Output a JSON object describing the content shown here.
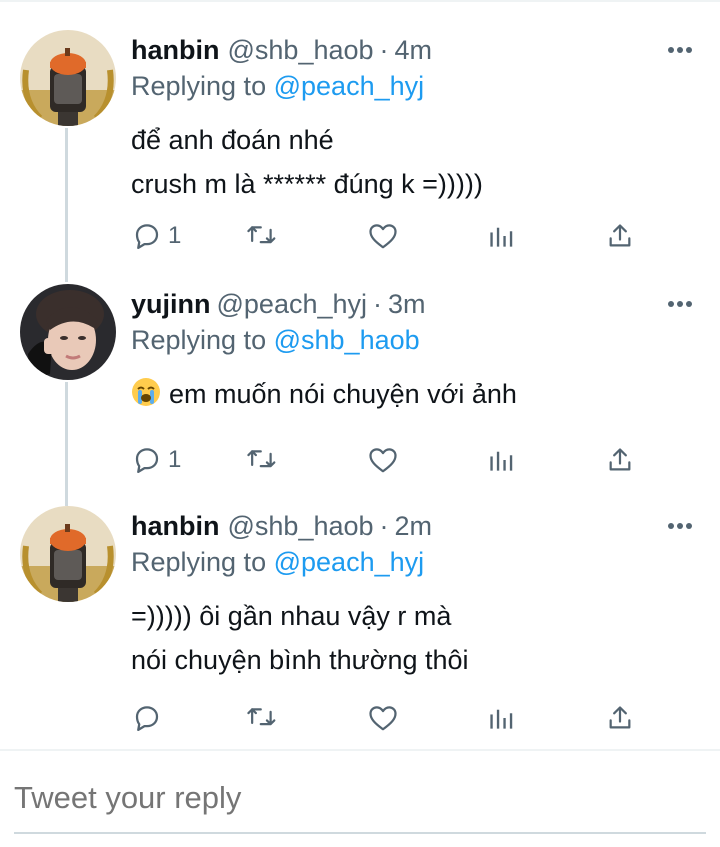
{
  "tweets": [
    {
      "display_name": "hanbin",
      "handle": "@shb_haob",
      "separator": "·",
      "time": "4m",
      "replying_prefix": "Replying to",
      "replying_to": "@peach_hyj",
      "lines": [
        "để anh đoán nhé",
        "crush m là ****** đúng k =)))))"
      ],
      "reply_count": "1"
    },
    {
      "display_name": "yujinn",
      "handle": "@peach_hyj",
      "separator": "·",
      "time": "3m",
      "replying_prefix": "Replying to",
      "replying_to": "@shb_haob",
      "lines": [
        "em muốn nói chuyện với ảnh"
      ],
      "reply_count": "1"
    },
    {
      "display_name": "hanbin",
      "handle": "@shb_haob",
      "separator": "·",
      "time": "2m",
      "replying_prefix": "Replying to",
      "replying_to": "@peach_hyj",
      "lines": [
        "=))))) ôi gần nhau vậy r mà",
        "nói chuyện bình thường thôi"
      ],
      "reply_count": ""
    }
  ],
  "compose": {
    "placeholder": "Tweet your reply"
  },
  "icons": {
    "more": "more-horizontal-icon",
    "reply": "reply-bubble-icon",
    "retweet": "retweet-icon",
    "like": "heart-icon",
    "analytics": "analytics-bars-icon",
    "share": "share-upload-icon",
    "emoji": "loudly-crying-face-emoji"
  },
  "colors": {
    "text": "#0f1419",
    "secondary": "#536471",
    "link": "#1d9bf0",
    "thread_line": "#cfd9de"
  }
}
